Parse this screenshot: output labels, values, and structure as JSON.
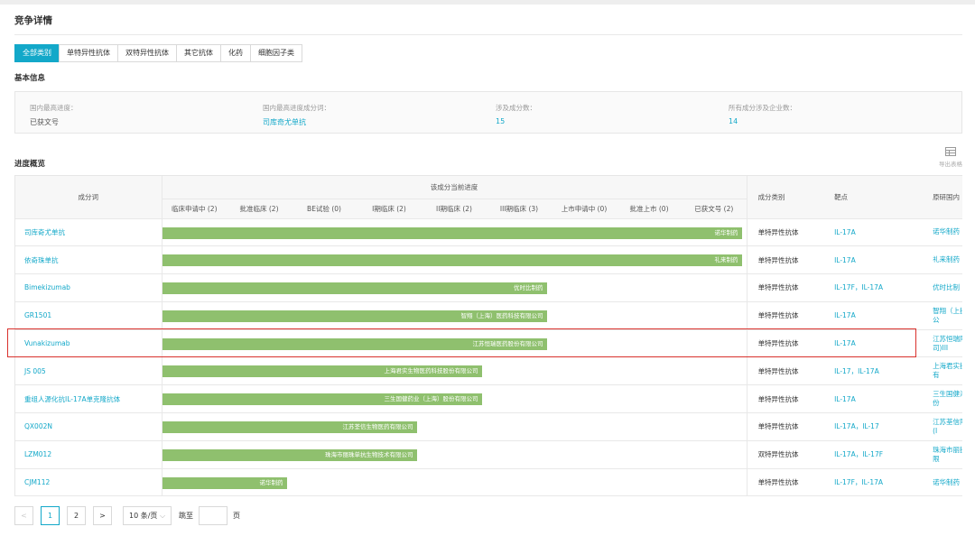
{
  "page": {
    "title": "竞争详情",
    "tabs": [
      {
        "label": "全部类别",
        "active": true
      },
      {
        "label": "单特异性抗体",
        "active": false
      },
      {
        "label": "双特异性抗体",
        "active": false
      },
      {
        "label": "其它抗体",
        "active": false
      },
      {
        "label": "化药",
        "active": false
      },
      {
        "label": "细胞因子类",
        "active": false
      }
    ]
  },
  "basic_info": {
    "heading": "基本信息",
    "items": [
      {
        "key": "国内最高进度：",
        "value": "已获文号"
      },
      {
        "key": "国内最高进度成分词：",
        "value": "司库奇尤单抗"
      },
      {
        "key": "涉及成分数：",
        "value": "15"
      },
      {
        "key": "所有成分涉及企业数：",
        "value": "14"
      }
    ]
  },
  "progress": {
    "heading": "进度概览",
    "export_label": "导出表格",
    "headers": {
      "name": "成分词",
      "stage_group": "该成分当前进度",
      "category": "成分类别",
      "target": "靶点",
      "originator": "原研国内"
    },
    "stages": [
      "临床申请中 (2)",
      "批准临床 (2)",
      "BE试验 (0)",
      "I期临床 (2)",
      "II期临床 (2)",
      "III期临床 (3)",
      "上市申请中 (0)",
      "批准上市 (0)",
      "已获文号 (2)"
    ],
    "rows": [
      {
        "name": "司库奇尤单抗",
        "stage_level": 9,
        "company": "诺华制药",
        "category": "单特异性抗体",
        "target": "IL-17A",
        "originator": "诺华制药"
      },
      {
        "name": "依奇珠单抗",
        "stage_level": 9,
        "company": "礼来制药",
        "category": "单特异性抗体",
        "target": "IL-17A",
        "originator": "礼来制药"
      },
      {
        "name": "Bimekizumab",
        "stage_level": 6,
        "company": "优时比制药",
        "category": "单特异性抗体",
        "target": "IL-17F，IL-17A",
        "originator": "优时比制"
      },
      {
        "name": "GR1501",
        "stage_level": 6,
        "company": "智翔（上海）医药科技有限公司",
        "category": "单特异性抗体",
        "target": "IL-17A",
        "originator": "智翔（上技有限公"
      },
      {
        "name": "Vunakizumab",
        "stage_level": 6,
        "company": "江苏恒瑞医药股份有限公司",
        "category": "单特异性抗体",
        "target": "IL-17A",
        "originator": "江苏恒瑞限公司)III"
      },
      {
        "name": "JS 005",
        "stage_level": 5,
        "company": "上海君实生物医药科技股份有限公司",
        "category": "单特异性抗体",
        "target": "IL-17，IL-17A",
        "originator": "上海君实技股份有"
      },
      {
        "name": "重组人源化抗IL-17A单克隆抗体",
        "stage_level": 5,
        "company": "三生国健药业（上海）股份有限公司",
        "category": "单特异性抗体",
        "target": "IL-17A",
        "originator": "三生国健海）股份"
      },
      {
        "name": "QX002N",
        "stage_level": 4,
        "company": "江苏荃信生物医药有限公司",
        "category": "单特异性抗体",
        "target": "IL-17A，IL-17",
        "originator": "江苏荃信限公司(I"
      },
      {
        "name": "LZM012",
        "stage_level": 4,
        "company": "珠海市丽珠单抗生物技术有限公司",
        "category": "双特异性抗体",
        "target": "IL-17A，IL-17F",
        "originator": "珠海市丽技术有限"
      },
      {
        "name": "CJM112",
        "stage_level": 2,
        "company": "诺华制药",
        "category": "单特异性抗体",
        "target": "IL-17F，IL-17A",
        "originator": "诺华制药"
      }
    ]
  },
  "pagination": {
    "prev": "<",
    "pages": [
      "1",
      "2"
    ],
    "current": "1",
    "next": ">",
    "page_size": "10 条/页",
    "jump_label": "跳至",
    "page_word": "页"
  },
  "colors": {
    "accent": "#13a8c9",
    "bar": "#8fc06e",
    "highlight": "#d9302c"
  }
}
